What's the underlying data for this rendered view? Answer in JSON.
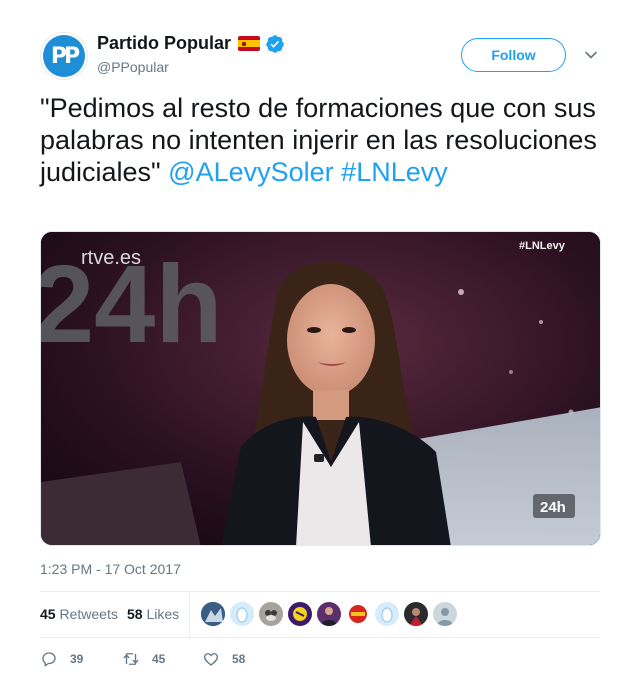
{
  "account": {
    "display_name": "Partido Popular",
    "handle": "@PPopular",
    "avatar_text": "PP",
    "verified": true,
    "flag_icon": "spain-flag-icon"
  },
  "follow_button": {
    "label": "Follow"
  },
  "tweet": {
    "quote": "\"Pedimos al resto de formaciones que con sus palabras no intenten injerir en las resoluciones judiciales\"",
    "mention": "@ALevySoler",
    "hashtag": "#LNLevy",
    "timestamp": "1:23 PM - 17 Oct 2017"
  },
  "media": {
    "channel_logo": "rtve.es",
    "channel_big": "24h",
    "hashtag_overlay": "#LNLevy",
    "corner_badge": "24h"
  },
  "stats": {
    "retweets_count": "45",
    "retweets_label": "Retweets",
    "likes_count": "58",
    "likes_label": "Likes",
    "liker_avatar_count": 9
  },
  "actions": {
    "replies": "39",
    "retweets": "45",
    "likes": "58"
  },
  "colors": {
    "link": "#1da1f2",
    "text": "#14171a",
    "muted": "#657786",
    "verified": "#1da1f2"
  }
}
